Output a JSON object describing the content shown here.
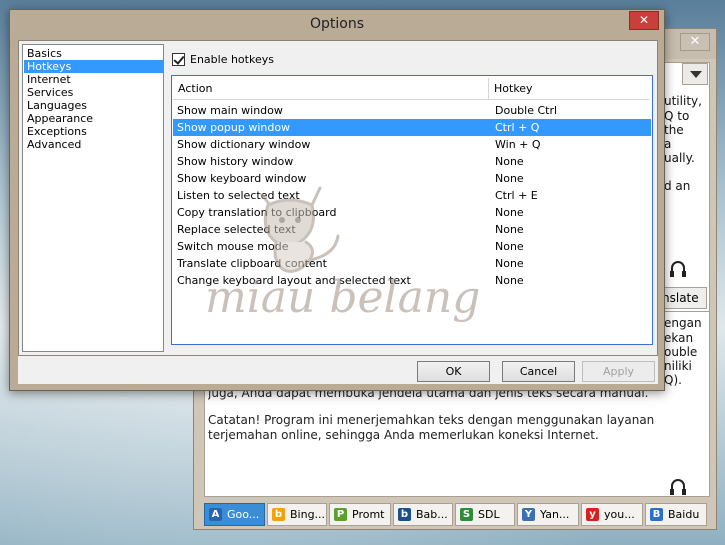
{
  "dialog": {
    "title": "Options",
    "close_label": "✕",
    "nav_items": [
      "Basics",
      "Hotkeys",
      "Internet",
      "Services",
      "Languages",
      "Appearance",
      "Exceptions",
      "Advanced"
    ],
    "enable_hotkeys_label": "Enable hotkeys",
    "table": {
      "headers": [
        "Action",
        "Hotkey"
      ],
      "rows": [
        [
          "Show main window",
          "Double Ctrl"
        ],
        [
          "Show popup window",
          "Ctrl + Q"
        ],
        [
          "Show dictionary window",
          "Win + Q"
        ],
        [
          "Show history window",
          "None"
        ],
        [
          "Show keyboard window",
          "None"
        ],
        [
          "Listen to selected text",
          "Ctrl + E"
        ],
        [
          "Copy translation to clipboard",
          "None"
        ],
        [
          "Replace selected text",
          "None"
        ],
        [
          "Switch mouse mode",
          "None"
        ],
        [
          "Translate clipboard content",
          "None"
        ],
        [
          "Change keyboard layout and selected text",
          "None"
        ]
      ]
    },
    "buttons": {
      "ok": "OK",
      "cancel": "Cancel",
      "apply": "Apply"
    }
  },
  "background_window": {
    "close_label": "✕",
    "top_text_fragments": [
      "utility,",
      "Q to",
      "the",
      "a",
      "ually.",
      "d an"
    ],
    "translate_label": "nslate",
    "bottom_text_fragments": [
      "engan",
      "ekan",
      "ouble",
      "niliki",
      "Q)."
    ],
    "hidden_line": "juga, Anda dapat membuka jendela utama dan jenis teks secara manual.",
    "note_para": "Catatan! Program ini menerjemahkan teks dengan menggunakan layanan terjemahan online, sehingga Anda memerlukan koneksi Internet.",
    "services": [
      {
        "label": "Goo...",
        "icon": "google-translate-icon",
        "color": "#3a78c9",
        "glyph": "A"
      },
      {
        "label": "Bing...",
        "icon": "bing-icon",
        "color": "#f0a30a",
        "glyph": "b"
      },
      {
        "label": "Promt",
        "icon": "promt-icon",
        "color": "#5aa02c",
        "glyph": "P"
      },
      {
        "label": "Bab...",
        "icon": "babylon-icon",
        "color": "#1b4f8a",
        "glyph": "b"
      },
      {
        "label": "SDL",
        "icon": "sdl-icon",
        "color": "#2e8b3a",
        "glyph": "S"
      },
      {
        "label": "Yan...",
        "icon": "yandex-icon",
        "color": "#3d6fb0",
        "glyph": "Y"
      },
      {
        "label": "you...",
        "icon": "youdao-icon",
        "color": "#d92020",
        "glyph": "y"
      },
      {
        "label": "Baidu",
        "icon": "baidu-icon",
        "color": "#2b6fd0",
        "glyph": "B"
      }
    ]
  },
  "watermark": {
    "text": "miau belang"
  },
  "colors": {
    "selection": "#3399ff",
    "close_red": "#c7413a",
    "table_border": "#3b6fd6"
  }
}
